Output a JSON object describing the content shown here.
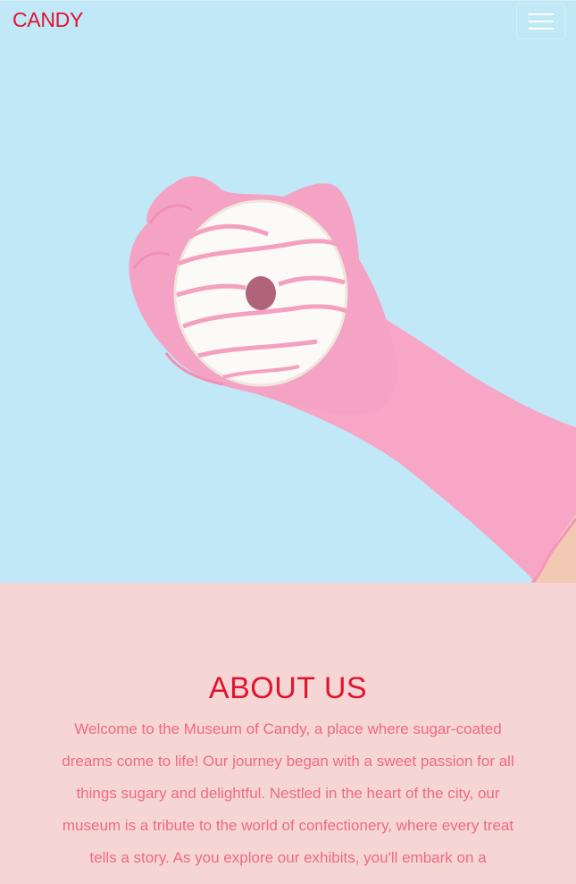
{
  "navbar": {
    "brand": "CANDY",
    "menu_icon": "hamburger-icon"
  },
  "hero": {
    "image": "pink-gloved-hand-holding-glazed-donut"
  },
  "about": {
    "heading": "ABOUT US",
    "body": "Welcome to the Museum of Candy, a place where sugar-coated dreams come to life! Our journey began with a sweet passion for all things sugary and delightful. Nestled in the heart of the city, our museum is a tribute to the world of confectionery, where every treat tells a story. As you explore our exhibits, you'll embark on a"
  },
  "colors": {
    "brand_red": "#e0142f",
    "body_pink": "#ef6a82",
    "hero_blue": "#c0e8f7",
    "section_pink": "#f5d6d4",
    "glove_pink": "#f7a8c8"
  }
}
